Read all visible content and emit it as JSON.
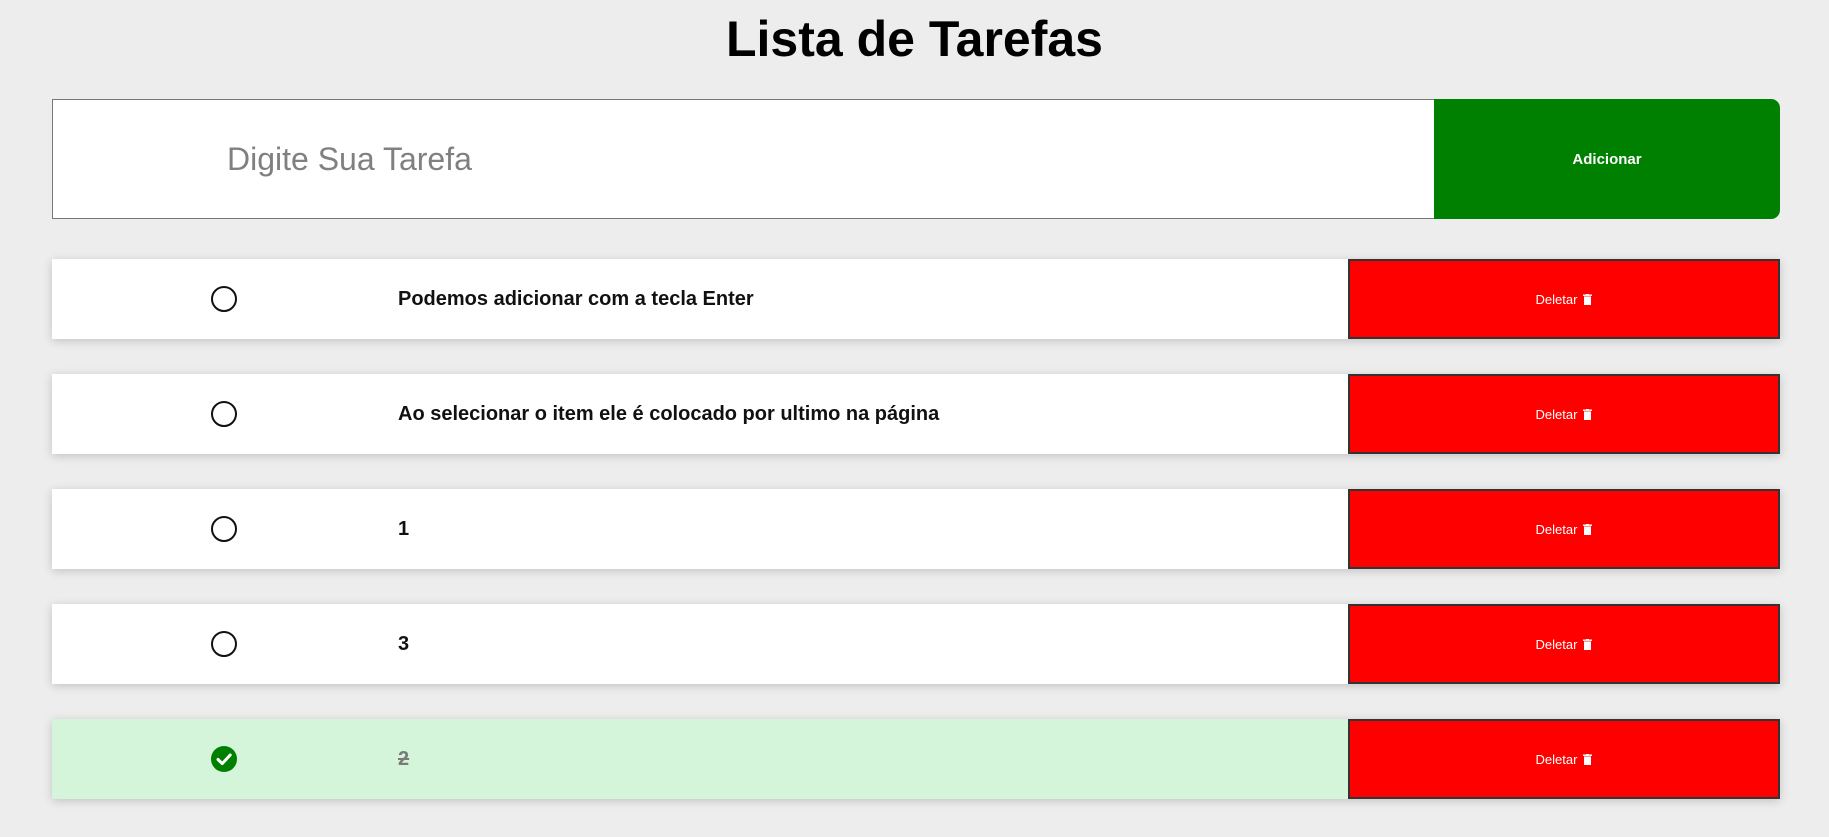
{
  "app": {
    "title": "Lista de Tarefas"
  },
  "add_form": {
    "input_placeholder": "Digite Sua Tarefa",
    "input_value": "",
    "add_label": "Adicionar"
  },
  "tasks": [
    {
      "text": "Podemos adicionar com a tecla Enter",
      "done": false,
      "delete_label": "Deletar",
      "delete_icon": "trash-icon"
    },
    {
      "text": "Ao selecionar o item ele é colocado por ultimo na página",
      "done": false,
      "delete_label": "Deletar",
      "delete_icon": "trash-icon"
    },
    {
      "text": "1",
      "done": false,
      "delete_label": "Deletar",
      "delete_icon": "trash-icon"
    },
    {
      "text": "3",
      "done": false,
      "delete_label": "Deletar",
      "delete_icon": "trash-icon"
    },
    {
      "text": "2",
      "done": true,
      "delete_label": "Deletar",
      "delete_icon": "trash-icon"
    }
  ],
  "colors": {
    "background": "#ededed",
    "add_button": "#008000",
    "delete_button": "#ff0000",
    "done_row": "#d4f5d9",
    "check_done": "#008000"
  }
}
